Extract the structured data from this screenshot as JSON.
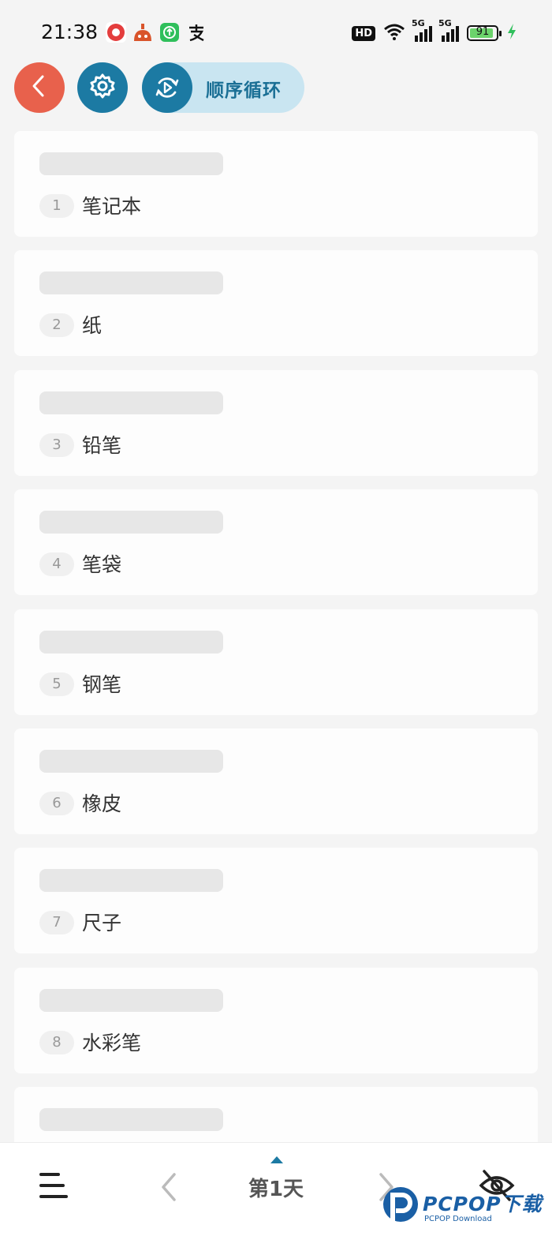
{
  "status_bar": {
    "time": "21:38",
    "hd_label": "HD",
    "network1": "5G",
    "network2": "5G",
    "battery_percent": "91",
    "battery_level": 0.91
  },
  "top_bar": {
    "loop_mode_label": "顺序循环"
  },
  "words": [
    {
      "index": "1",
      "word": "笔记本"
    },
    {
      "index": "2",
      "word": "纸"
    },
    {
      "index": "3",
      "word": "铅笔"
    },
    {
      "index": "4",
      "word": "笔袋"
    },
    {
      "index": "5",
      "word": "钢笔"
    },
    {
      "index": "6",
      "word": "橡皮"
    },
    {
      "index": "7",
      "word": "尺子"
    },
    {
      "index": "8",
      "word": "水彩笔"
    },
    {
      "index": "",
      "word": ""
    }
  ],
  "bottom_bar": {
    "day_label": "第1天"
  },
  "watermark": {
    "text": "PCPOP下载",
    "sub": "PCPOP Download"
  },
  "colors": {
    "back_button": "#e8614c",
    "accent": "#1c7aa3",
    "pill_bg": "#c9e5f1"
  },
  "icons": [
    "back-icon",
    "gear-icon",
    "loop-play-icon",
    "menu-icon",
    "chevron-left-icon",
    "chevron-right-icon",
    "eye-off-icon"
  ]
}
